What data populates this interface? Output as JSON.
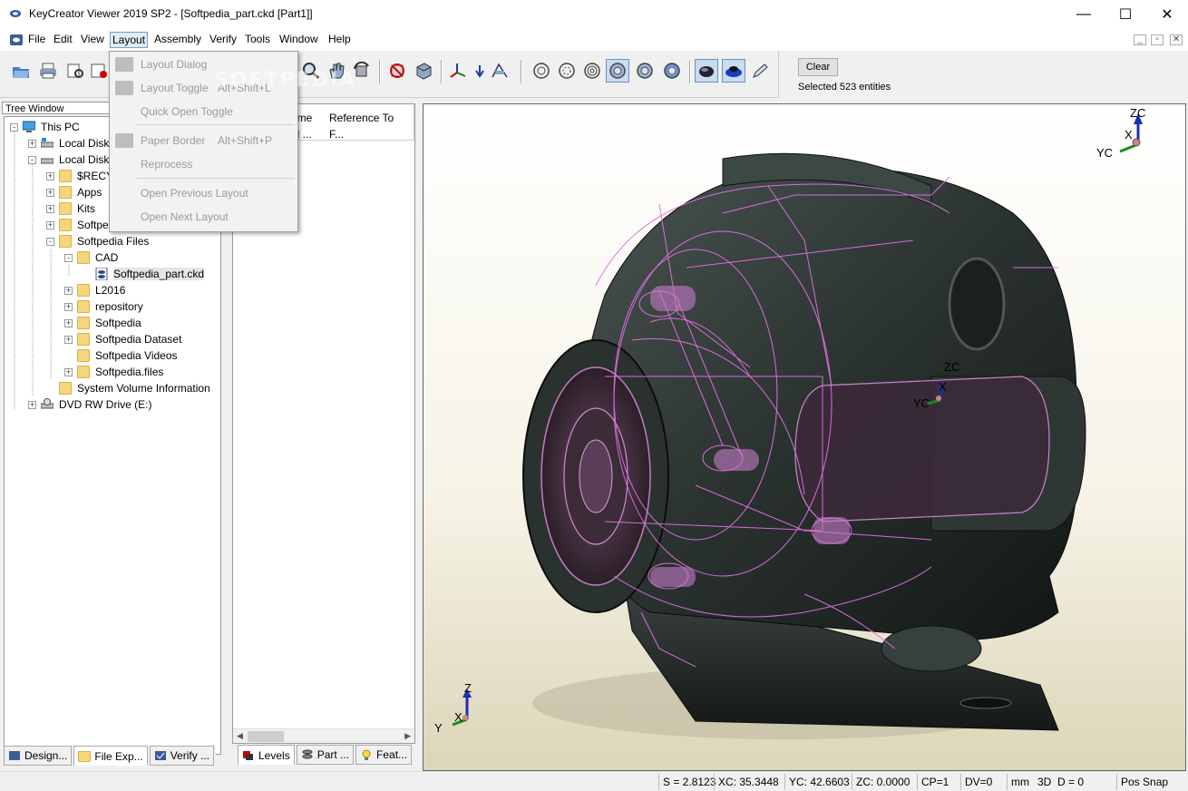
{
  "window": {
    "title": "KeyCreator Viewer 2019 SP2 - [Softpedia_part.ckd [Part1]]",
    "minimize": "—",
    "maximize": "☐",
    "close": "✕"
  },
  "menu": {
    "items": [
      "File",
      "Edit",
      "View",
      "Layout",
      "Assembly",
      "Verify",
      "Tools",
      "Window",
      "Help"
    ],
    "active": "Layout",
    "mdi_minimize": "_",
    "mdi_restore": "▫",
    "mdi_close": "✕"
  },
  "layout_menu": {
    "items": [
      {
        "label": "Layout Dialog",
        "shortcut": "",
        "icon": "layout-dialog-icon",
        "enabled": false
      },
      {
        "label": "Layout Toggle",
        "shortcut": "Alt+Shift+L",
        "icon": "layout-toggle-icon",
        "enabled": false
      },
      {
        "label": "Quick Open Toggle",
        "shortcut": "",
        "icon": "",
        "enabled": false
      },
      {
        "label": "Paper Border",
        "shortcut": "Alt+Shift+P",
        "icon": "paper-border-icon",
        "enabled": false
      },
      {
        "label": "Reprocess",
        "shortcut": "",
        "icon": "",
        "enabled": false
      },
      {
        "label": "Open Previous Layout",
        "shortcut": "",
        "icon": "",
        "enabled": false
      },
      {
        "label": "Open Next Layout",
        "shortcut": "",
        "icon": "",
        "enabled": false
      }
    ]
  },
  "selection_panel": {
    "clear_label": "Clear",
    "status": "Selected 523 entities"
  },
  "tree": {
    "header": "Tree Window",
    "rows": [
      {
        "label": "This PC",
        "icon": "computer-icon",
        "exp": "-"
      },
      {
        "label": "Local Disk",
        "icon": "drive-icon",
        "exp": "+"
      },
      {
        "label": "Local Disk",
        "icon": "drive-icon",
        "exp": "-"
      },
      {
        "label": "$RECY",
        "icon": "folder-icon",
        "exp": "+"
      },
      {
        "label": "Apps",
        "icon": "folder-icon",
        "exp": "+"
      },
      {
        "label": "Kits",
        "icon": "folder-icon",
        "exp": "+"
      },
      {
        "label": "Softpe",
        "icon": "folder-icon",
        "exp": "+"
      },
      {
        "label": "Softpedia Files",
        "icon": "folder-icon",
        "exp": "-"
      },
      {
        "label": "CAD",
        "icon": "folder-icon",
        "exp": "-"
      },
      {
        "label": "Softpedia_part.ckd",
        "icon": "ckd-file-icon",
        "exp": ""
      },
      {
        "label": "L2016",
        "icon": "folder-icon",
        "exp": "+"
      },
      {
        "label": "repository",
        "icon": "folder-icon",
        "exp": "+"
      },
      {
        "label": "Softpedia",
        "icon": "folder-icon",
        "exp": "+"
      },
      {
        "label": "Softpedia Dataset",
        "icon": "folder-icon",
        "exp": "+"
      },
      {
        "label": "Softpedia Videos",
        "icon": "folder-icon",
        "exp": ""
      },
      {
        "label": "Softpedia.files",
        "icon": "folder-icon",
        "exp": "+"
      },
      {
        "label": "System Volume Information",
        "icon": "folder-icon",
        "exp": ""
      },
      {
        "label": "DVD RW Drive (E:)",
        "icon": "dvd-drive-icon",
        "exp": "+"
      }
    ]
  },
  "left_tabs": [
    "Design...",
    "File Exp...",
    "Verify ..."
  ],
  "mid_panel": {
    "col1_line1": "ame",
    "col1_line2": "el ...",
    "col2": "Reference To F..."
  },
  "mid_tabs": [
    "Levels",
    "Part ...",
    "Feat..."
  ],
  "watermark": "SOFTPEDIA",
  "axes": {
    "corner": {
      "z": "ZC",
      "x": "X",
      "y": "YC"
    },
    "center": {
      "z": "ZC",
      "x": "X",
      "y": "YC"
    },
    "bottom": {
      "z": "Z",
      "x": "X",
      "y": "Y"
    }
  },
  "status": {
    "s": "S = 2.8123",
    "xc": "XC: 35.3448",
    "yc": "YC: 42.6603",
    "zc": "ZC: 0.0000",
    "cp": "CP=1",
    "dv": "DV=0",
    "unit": "mm",
    "mode": "3D",
    "d": "D = 0",
    "snap": "Pos Snap"
  }
}
